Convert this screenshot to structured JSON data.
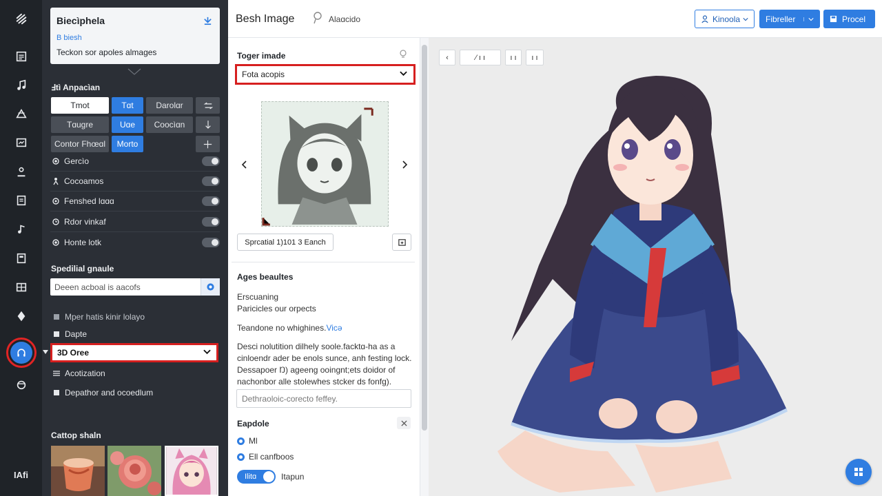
{
  "rail": {
    "icons": [
      "logo-icon",
      "list-icon",
      "music-icon",
      "shape-icon",
      "image-icon",
      "user-icon",
      "document-icon",
      "note-icon",
      "frame-icon",
      "grid-icon",
      "diamond-icon",
      "headphones-icon",
      "circle-icon"
    ],
    "bottom_label": "IAfi"
  },
  "left_panel": {
    "card": {
      "title": "Biecìphela",
      "subtitle": "Β biesh",
      "description": "Teckon sor apoles almages"
    },
    "section1_label": "Ⅎtì Anpacìan",
    "option_buttons": [
      "Tmot",
      "Tɑt",
      "Darolɑr",
      "Tɑugre",
      "Uɑe",
      "Coocìɑn",
      "Contor Fhœɑl",
      "Morto"
    ],
    "toggles": [
      {
        "label": "Gercìo"
      },
      {
        "label": "Cocoamos"
      },
      {
        "label": "Fenshed lɑɑɑ"
      },
      {
        "label": "Rdor vinkaf"
      },
      {
        "label": "Honte lotk"
      }
    ],
    "special_label": "Spedilial gnaule",
    "special_input": "Deeen acboal is aacofs",
    "list_rows": [
      "Mper hatis kinir lolayo",
      "Dapte"
    ],
    "style_select": "3D Oree",
    "list_rows2": [
      "Acotization",
      "Depathor and ocoedlum"
    ],
    "gallery_label": "Cattop shaln"
  },
  "header": {
    "title": "Besh Image",
    "subtitle": "Alaɑcido",
    "btn_account": "Kinoola",
    "btn_feature": "Fibreller",
    "btn_proceed": "Procel"
  },
  "middle": {
    "target_label": "Toger imade",
    "target_select": "Fota acopis",
    "size_pill": "Sprcatial 1)101 3 Eanch",
    "ages_label": "Ages beaultes",
    "ages_line1": "Erscuaning",
    "ages_line2": "Paricicles our orpects",
    "prompt_heading_prefix": "Teandone no whighines.",
    "prompt_heading_link": "Vicə",
    "prompt_body1": "Desci nolutition dilhely soole.facktɑ-ha as a",
    "prompt_body2": "cinloendr ader be enols sunce, anh festing lock.",
    "prompt_body3": "Dessapoer Ŋ) ageeng ooingnt;ets doidor of",
    "prompt_body4": "nachonbor alle stolewhes stcker ds fonfg).",
    "neg_input": "Dethraoloic-corecto feffey.",
    "extra_label": "Eapdole",
    "radio1": "Ml",
    "radio2": "Ell canfboos",
    "toggle_on": "Ilitɑ",
    "toggle_label": "Itapun"
  },
  "canvas": {
    "toolbar": [
      "‹",
      "⁄ ı ı",
      "ı ı",
      "ı ı"
    ]
  },
  "colors": {
    "accent": "#2f7de1",
    "highlight": "#d61f1f",
    "panel_dark": "#2b2f36",
    "rail_dark": "#1f2328"
  }
}
